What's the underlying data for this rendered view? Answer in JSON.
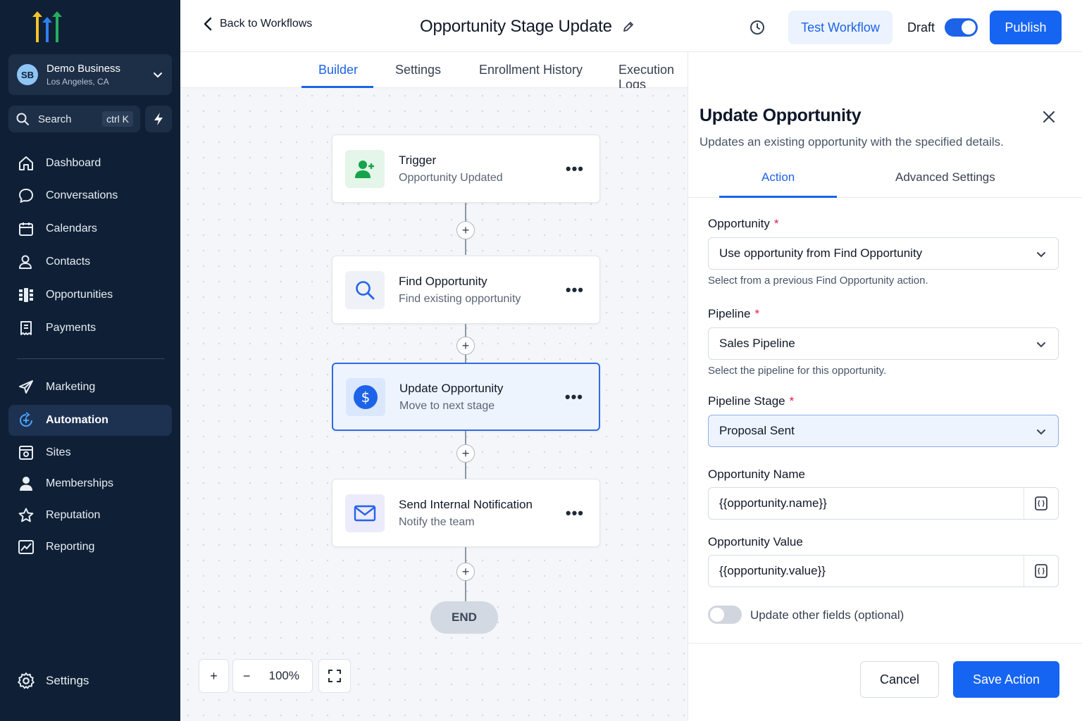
{
  "sidebar": {
    "business": {
      "initials": "SB",
      "name": "Demo Business",
      "location": "Los Angeles, CA"
    },
    "search": {
      "label": "Search",
      "shortcut": "ctrl K"
    },
    "items": [
      {
        "label": "Dashboard",
        "icon": "home-icon"
      },
      {
        "label": "Conversations",
        "icon": "chat-icon"
      },
      {
        "label": "Calendars",
        "icon": "calendar-icon"
      },
      {
        "label": "Contacts",
        "icon": "contacts-icon"
      },
      {
        "label": "Opportunities",
        "icon": "opportunities-icon"
      },
      {
        "label": "Payments",
        "icon": "payments-icon"
      },
      {
        "label": "Marketing",
        "icon": "send-icon"
      },
      {
        "label": "Automation",
        "icon": "automation-icon"
      },
      {
        "label": "Sites",
        "icon": "sites-icon"
      },
      {
        "label": "Memberships",
        "icon": "user-icon"
      },
      {
        "label": "Reputation",
        "icon": "star-icon"
      },
      {
        "label": "Reporting",
        "icon": "chart-icon"
      },
      {
        "label": "Settings",
        "icon": "gear-icon"
      }
    ],
    "active_item": "Automation"
  },
  "header": {
    "back_label": "Back to Workflows",
    "title": "Opportunity Stage Update",
    "test_label": "Test Workflow",
    "draft_label": "Draft",
    "publish_label": "Publish"
  },
  "tabs": [
    {
      "label": "Builder"
    },
    {
      "label": "Settings"
    },
    {
      "label": "Enrollment History"
    },
    {
      "label": "Execution Logs"
    }
  ],
  "active_tab": "Builder",
  "workflow": {
    "nodes": [
      {
        "title": "Trigger",
        "subtitle": "Opportunity Updated",
        "icon": "user-add-icon"
      },
      {
        "title": "Find Opportunity",
        "subtitle": "Find existing opportunity",
        "icon": "search-icon"
      },
      {
        "title": "Update Opportunity",
        "subtitle": "Move to next stage",
        "icon": "dollar-icon"
      },
      {
        "title": "Send Internal Notification",
        "subtitle": "Notify the team",
        "icon": "mail-icon"
      }
    ],
    "end_label": "END",
    "plus_label": "+",
    "more_label": "•••"
  },
  "zoom": {
    "in_label": "+",
    "out_label": "−",
    "level": "100%"
  },
  "panel": {
    "title": "Update Opportunity",
    "subtitle": "Updates an existing opportunity with the specified details.",
    "tabs": [
      "Action",
      "Advanced Settings"
    ],
    "fields": {
      "opportunity": {
        "label": "Opportunity",
        "required": "*",
        "value": "Use opportunity from Find Opportunity",
        "help": "Select from a previous Find Opportunity action."
      },
      "pipeline": {
        "label": "Pipeline",
        "required": "*",
        "value": "Sales Pipeline",
        "help": "Select the pipeline for this opportunity."
      },
      "stage": {
        "label": "Pipeline Stage",
        "required": "*",
        "value": "Proposal Sent"
      },
      "name": {
        "label": "Opportunity Name",
        "value": "{{opportunity.name}}"
      },
      "value": {
        "label": "Opportunity Value",
        "value": "{{opportunity.value}}"
      }
    },
    "toggle_label": "Update other fields (optional)",
    "cancel_label": "Cancel",
    "save_label": "Save Action"
  },
  "colors": {
    "accent": "#1664f2",
    "sidebar_bg": "#0f2036",
    "required": "#e11d48"
  }
}
